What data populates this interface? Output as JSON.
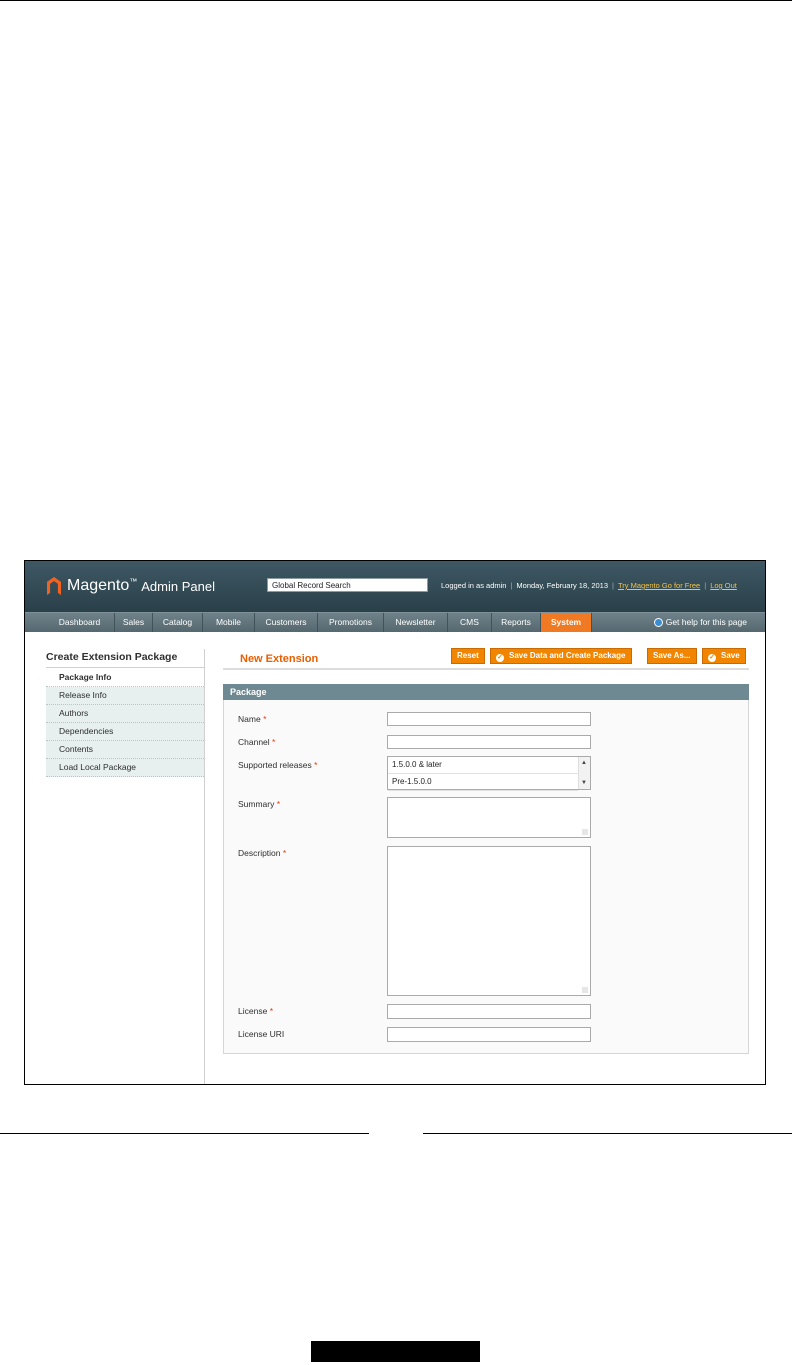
{
  "header": {
    "logo_name": "Magento",
    "logo_trademark": "™",
    "logo_subtitle": "Admin Panel",
    "search_value": "Global Record Search",
    "logged_in": "Logged in as admin",
    "date": "Monday, February 18, 2013",
    "try_link": "Try Magento Go for Free",
    "logout": "Log Out"
  },
  "nav": {
    "items": [
      "Dashboard",
      "Sales",
      "Catalog",
      "Mobile",
      "Customers",
      "Promotions",
      "Newsletter",
      "CMS",
      "Reports",
      "System"
    ],
    "active": "System",
    "help": "Get help for this page"
  },
  "sidebar": {
    "title": "Create Extension Package",
    "items": [
      "Package Info",
      "Release Info",
      "Authors",
      "Dependencies",
      "Contents",
      "Load Local Package"
    ],
    "active": "Package Info"
  },
  "main": {
    "title": "New Extension",
    "buttons": {
      "reset": "Reset",
      "save_create": "Save Data and Create Package",
      "save_as": "Save As...",
      "save": "Save"
    },
    "section_title": "Package",
    "required_mark": "*",
    "fields": {
      "name": "Name",
      "channel": "Channel",
      "supported_releases": "Supported releases",
      "summary": "Summary",
      "description": "Description",
      "license": "License",
      "license_uri": "License URI"
    },
    "release_options": [
      "1.5.0.0 & later",
      "Pre-1.5.0.0"
    ]
  },
  "colors": {
    "header_bg": "#2a4049",
    "nav_active": "#f07a23",
    "button": "#f18500",
    "title": "#eb5e00",
    "section_header": "#6f8992"
  }
}
